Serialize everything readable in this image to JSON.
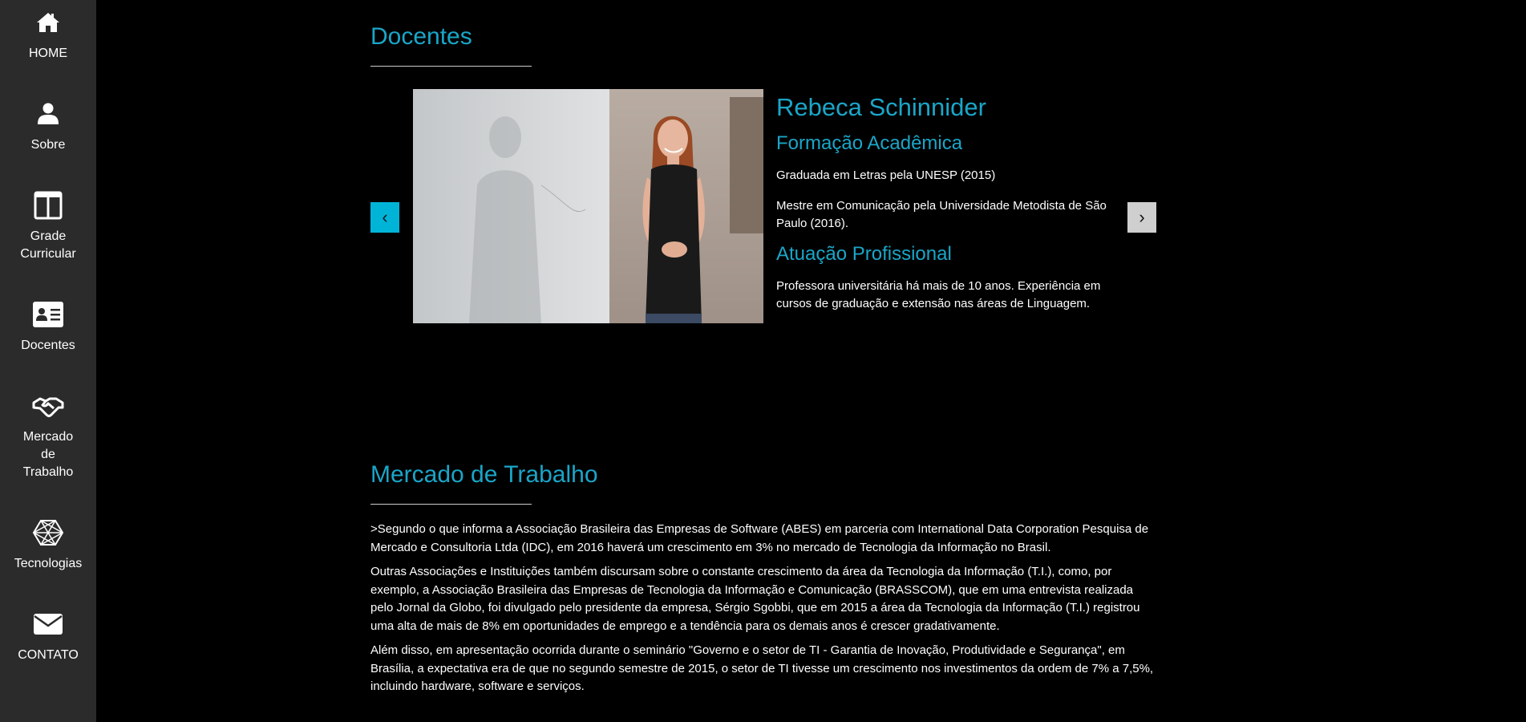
{
  "sidebar": {
    "items": [
      {
        "label": "HOME",
        "icon": "home-icon"
      },
      {
        "label": "Sobre",
        "icon": "user-icon"
      },
      {
        "label": "Grade\nCurricular",
        "icon": "columns-icon"
      },
      {
        "label": "Docentes",
        "icon": "id-card-icon"
      },
      {
        "label": "Mercado\nde\nTrabalho",
        "icon": "handshake-icon"
      },
      {
        "label": "Tecnologias",
        "icon": "network-icon"
      },
      {
        "label": "CONTATO",
        "icon": "envelope-icon"
      }
    ]
  },
  "docentes": {
    "title": "Docentes",
    "prev_label": "‹",
    "next_label": "›",
    "teacher": {
      "name": "Rebeca Schinnider",
      "formacao_title": "Formação Acadêmica",
      "formacao_1": "Graduada em Letras pela UNESP (2015)",
      "formacao_2": "Mestre em Comunicação pela Universidade Metodista de São Paulo (2016).",
      "atuacao_title": "Atuação Profissional",
      "atuacao_1": "Professora universitária há mais de 10 anos. Experiência em cursos de graduação e extensão nas áreas de Linguagem."
    }
  },
  "mercado": {
    "title": "Mercado de Trabalho",
    "paragraphs": [
      ">Segundo o que informa a Associação Brasileira das Empresas de Software (ABES) em parceria com International Data Corporation Pesquisa de Mercado e Consultoria Ltda (IDC), em 2016 haverá um crescimento em 3% no mercado de Tecnologia da Informação no Brasil.",
      "Outras Associações e Instituições também discursam sobre o constante crescimento da área da Tecnologia da Informação (T.I.), como, por exemplo, a Associação Brasileira das Empresas de Tecnologia da Informação e Comunicação (BRASSCOM), que em uma entrevista realizada pelo Jornal da Globo, foi divulgado pelo presidente da empresa, Sérgio Sgobbi, que em 2015 a área da Tecnologia da Informação (T.I.) registrou uma alta de mais de 8% em oportunidades de emprego e a tendência para os demais anos é crescer gradativamente.",
      "Além disso, em apresentação ocorrida durante o seminário \"Governo e o setor de TI - Garantia de Inovação, Produtividade e Segurança\", em Brasília, a expectativa era de que no segundo semestre de 2015, o setor de TI tivesse um crescimento nos investimentos da ordem de 7% a 7,5%, incluindo hardware, software e serviços."
    ]
  },
  "colors": {
    "accent": "#1aa6c8",
    "sidebar_bg": "#2b2b2b",
    "page_bg": "#000000",
    "prev_btn": "#00b4d8",
    "next_btn": "#cfcfcf"
  }
}
